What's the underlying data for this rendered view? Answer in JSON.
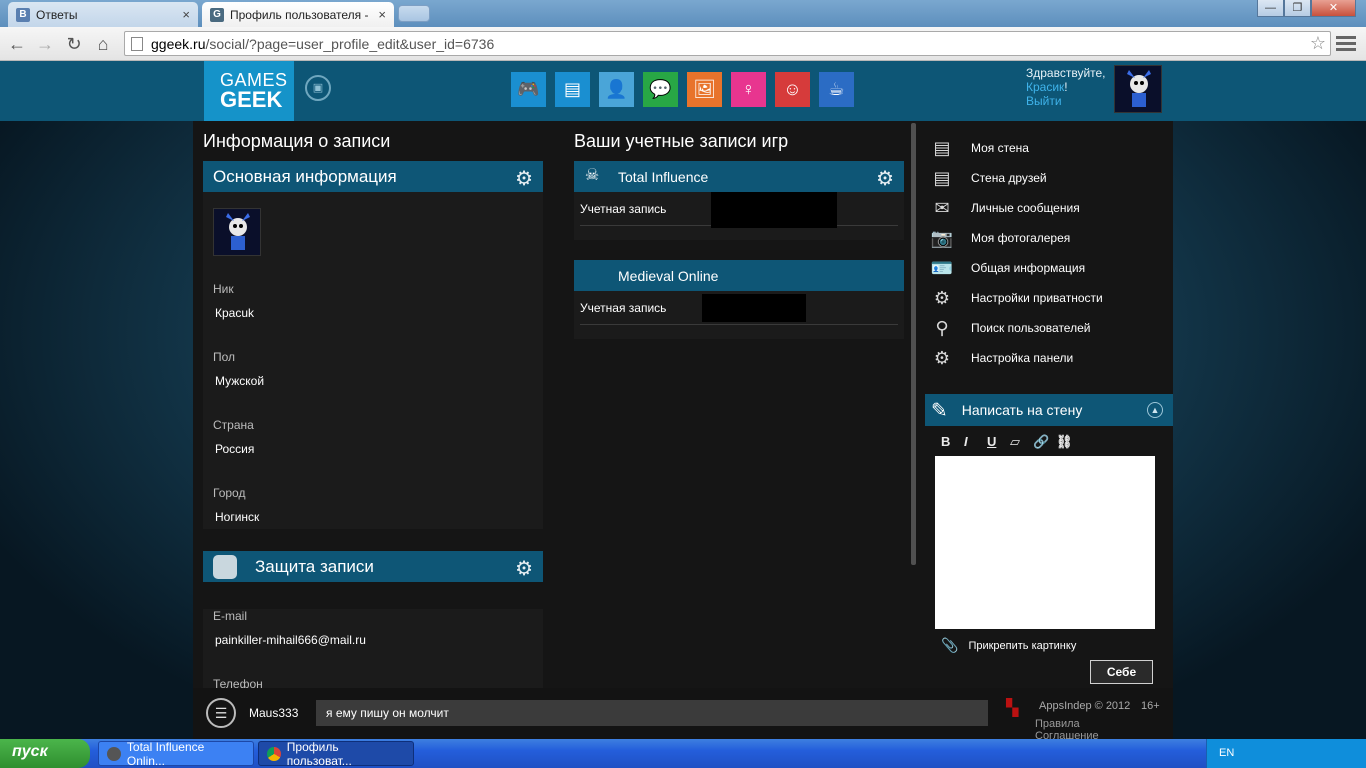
{
  "browser": {
    "tabs": [
      {
        "favicon": "В",
        "title": "Ответы",
        "close": "×"
      },
      {
        "favicon": "G",
        "title": "Профиль пользователя - G",
        "close": "×"
      }
    ],
    "controls": {
      "minimize": "—",
      "maximize": "❐",
      "close": "✕"
    },
    "url_host": "ggeek.ru",
    "url_path": "/social/?page=user_profile_edit&user_id=6736"
  },
  "header": {
    "logo_line1": "GAMES",
    "logo_line2": "GEEK",
    "greeting": "Здравствуйте,",
    "username": "Красик",
    "exclaim": "!",
    "logout": "Выйти",
    "nav_icons": [
      {
        "name": "games-icon",
        "color": "#1a8fd1",
        "glyph": "🎮"
      },
      {
        "name": "news-icon",
        "color": "#1a8fd1",
        "glyph": "▤"
      },
      {
        "name": "profile-icon",
        "color": "#4aa5d8",
        "glyph": "👤"
      },
      {
        "name": "chat-icon",
        "color": "#28a745",
        "glyph": "💬"
      },
      {
        "name": "gallery-icon",
        "color": "#e8732b",
        "glyph": "🖼"
      },
      {
        "name": "girl-icon",
        "color": "#e8358f",
        "glyph": "♀"
      },
      {
        "name": "anime-icon",
        "color": "#d63b3b",
        "glyph": "☺"
      },
      {
        "name": "cafe-icon",
        "color": "#2b6cc4",
        "glyph": "☕"
      }
    ]
  },
  "col1": {
    "title": "Информация о записи",
    "basic_section": "Основная информация",
    "fields": [
      {
        "label": "Ник",
        "value": "Красuk"
      },
      {
        "label": "Пол",
        "value": "Мужской"
      },
      {
        "label": "Страна",
        "value": "Россия"
      },
      {
        "label": "Город",
        "value": "Ногинск"
      }
    ],
    "security_section": "Защита записи",
    "email_label": "E-mail",
    "email_value": "painkiller-mihail666@mail.ru",
    "phone_label": "Телефон"
  },
  "col2": {
    "title": "Ваши учетные записи игр",
    "games": [
      {
        "name": "Total Influence",
        "account_label": "Учетная запись"
      },
      {
        "name": "Medieval Online",
        "account_label": "Учетная запись"
      }
    ]
  },
  "col3": {
    "menu": [
      {
        "icon": "wall-icon",
        "glyph": "▤",
        "label": "Моя стена"
      },
      {
        "icon": "friends-wall-icon",
        "glyph": "▤",
        "label": "Стена друзей"
      },
      {
        "icon": "mail-icon",
        "glyph": "✉",
        "label": "Личные сообщения"
      },
      {
        "icon": "camera-icon",
        "glyph": "📷",
        "label": "Моя фотогалерея"
      },
      {
        "icon": "id-card-icon",
        "glyph": "🪪",
        "label": "Общая информация"
      },
      {
        "icon": "gear-icon",
        "glyph": "⚙",
        "label": "Настройки приватности"
      },
      {
        "icon": "search-icon",
        "glyph": "⚲",
        "label": "Поиск пользователей"
      },
      {
        "icon": "panel-settings-icon",
        "glyph": "⚙",
        "label": "Настройка панели"
      }
    ],
    "wall_title": "Написать на стену",
    "editor_tools": [
      {
        "name": "bold-icon",
        "glyph": "B"
      },
      {
        "name": "italic-icon",
        "glyph": "I"
      },
      {
        "name": "underline-icon",
        "glyph": "U"
      },
      {
        "name": "eraser-icon",
        "glyph": "▱"
      },
      {
        "name": "link-icon",
        "glyph": "🔗"
      },
      {
        "name": "unlink-icon",
        "glyph": "⛓"
      }
    ],
    "attach": "Прикрепить картинку",
    "self_button": "Себе"
  },
  "chat": {
    "user": "Maus333",
    "message": "я ему пишу он молчит"
  },
  "footer": {
    "copyright": "AppsIndep © 2012",
    "age": "16+",
    "rules": "Правила",
    "agreement": "Соглашение"
  },
  "taskbar": {
    "start": "пуск",
    "tasks": [
      "Total Influence Onlin...",
      "Профиль пользоват..."
    ],
    "lang": "EN"
  }
}
